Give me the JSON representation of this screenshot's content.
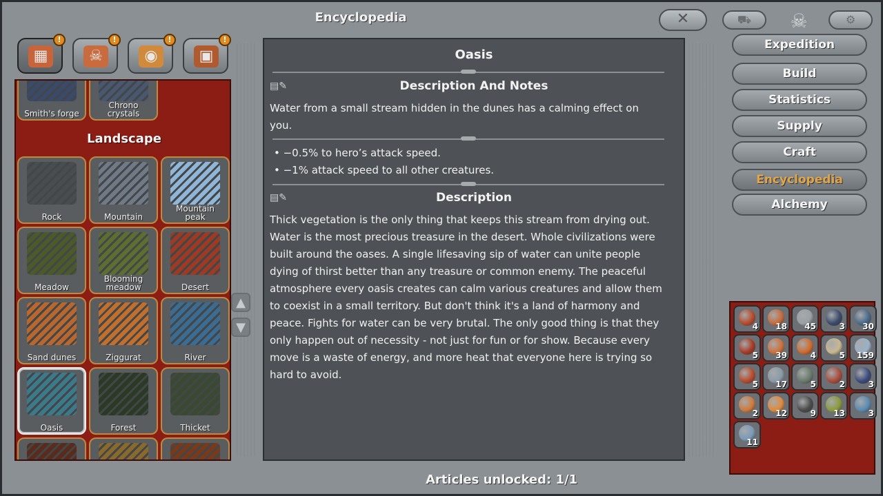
{
  "window": {
    "title": "Encyclopedia",
    "close_icon": "close-icon"
  },
  "category_tabs": [
    {
      "icon": "map-tile-icon",
      "glyph": "▦",
      "color": "#c8643a",
      "alert": "!"
    },
    {
      "icon": "skull-creature-icon",
      "glyph": "☠",
      "color": "#c86b3f",
      "alert": "!"
    },
    {
      "icon": "chest-items-icon",
      "glyph": "◉",
      "color": "#d18a3c",
      "alert": "!"
    },
    {
      "icon": "barrel-resources-icon",
      "glyph": "▣",
      "color": "#b05a30",
      "alert": "!"
    }
  ],
  "tiles": {
    "top_partial": [
      {
        "label": "Smith's forge",
        "color": "#3a4a6a"
      },
      {
        "label": "Chrono\ncrystals",
        "color": "#485870"
      }
    ],
    "section_title": "Landscape",
    "rows": [
      [
        {
          "label": "Rock",
          "color": "#4a4d50"
        },
        {
          "label": "Mountain",
          "color": "#6f7a86"
        },
        {
          "label": "Mountain\npeak",
          "color": "#8fb6d6"
        }
      ],
      [
        {
          "label": "Meadow",
          "color": "#4c5a2a"
        },
        {
          "label": "Blooming\nmeadow",
          "color": "#5e6e30"
        },
        {
          "label": "Desert",
          "color": "#9c3a24"
        }
      ],
      [
        {
          "label": "Sand dunes",
          "color": "#b8672e"
        },
        {
          "label": "Ziggurat",
          "color": "#c0702c"
        },
        {
          "label": "River",
          "color": "#3a6c94"
        }
      ],
      [
        {
          "label": "Oasis",
          "color": "#3b7a8a",
          "selected": true
        },
        {
          "label": "Forest",
          "color": "#2a3a24"
        },
        {
          "label": "Thicket",
          "color": "#3a4a30"
        }
      ]
    ],
    "bottom_partial": [
      {
        "color": "#5a2a1a"
      },
      {
        "color": "#8a6a2a"
      },
      {
        "color": "#7a3a1a"
      }
    ]
  },
  "scroll": {
    "up_icon": "scroll-up-icon",
    "down_icon": "scroll-down-icon"
  },
  "article": {
    "title": "Oasis",
    "notes_heading": "Description And Notes",
    "notes_text": "Water from a small stream hidden in the dunes has a calming effect on you.",
    "effects": [
      "• −0.5% to hero’s attack speed.",
      "• −1% attack speed to all other creatures."
    ],
    "description_heading": "Description",
    "description_text": "Thick vegetation is the only thing that keeps this stream from drying out. Water is the most precious treasure in the desert. Whole civilizations were built around the oases. A single lifesaving sip of water can unite people dying of thirst better than any treasure or common enemy. The peaceful atmosphere every oasis creates can calm various creatures and allow them to coexist in a small territory. But don't think it's a land of harmony and peace. Fights for water can be very brutal. The only good thing is that they only happen out of necessity - not just for fun or for show. Because every move is a waste of energy, and more heat that everyone here is trying so hard to avoid."
  },
  "footer": {
    "unlocked": "Articles unlocked: 1/1"
  },
  "menu": [
    {
      "label": "Expedition",
      "name": "menu-expedition"
    },
    {
      "label": "Build",
      "name": "menu-build"
    },
    {
      "label": "Statistics",
      "name": "menu-statistics"
    },
    {
      "label": "Supply",
      "name": "menu-supply"
    },
    {
      "label": "Craft",
      "name": "menu-craft"
    },
    {
      "label": "Encyclopedia",
      "name": "menu-encyclopedia",
      "active": true
    },
    {
      "label": "Alchemy",
      "name": "menu-alchemy"
    }
  ],
  "inventory": [
    {
      "count": "4",
      "color": "#b84a2a"
    },
    {
      "count": "18",
      "color": "#c86a3a"
    },
    {
      "count": "45",
      "color": "#9aa0a4"
    },
    {
      "count": "3",
      "color": "#3a4a6a"
    },
    {
      "count": "30",
      "color": "#4a6a8a"
    },
    {
      "count": "5",
      "color": "#a83a24"
    },
    {
      "count": "39",
      "color": "#d0703a"
    },
    {
      "count": "4",
      "color": "#d06a2a"
    },
    {
      "count": "5",
      "color": "#c8b890"
    },
    {
      "count": "159",
      "color": "#9ab0c8"
    },
    {
      "count": "5",
      "color": "#b84a2a"
    },
    {
      "count": "17",
      "color": "#8a9aa8"
    },
    {
      "count": "5",
      "color": "#6a7a6a"
    },
    {
      "count": "2",
      "color": "#a84a3a"
    },
    {
      "count": "3",
      "color": "#3a4a7a"
    },
    {
      "count": "2",
      "color": "#d07a3a"
    },
    {
      "count": "12",
      "color": "#e08a3a"
    },
    {
      "count": "9",
      "color": "#4a4a4a"
    },
    {
      "count": "13",
      "color": "#8a9a3a"
    },
    {
      "count": "3",
      "color": "#5a8ab0"
    },
    {
      "count": "11",
      "color": "#7a9ab8"
    }
  ]
}
